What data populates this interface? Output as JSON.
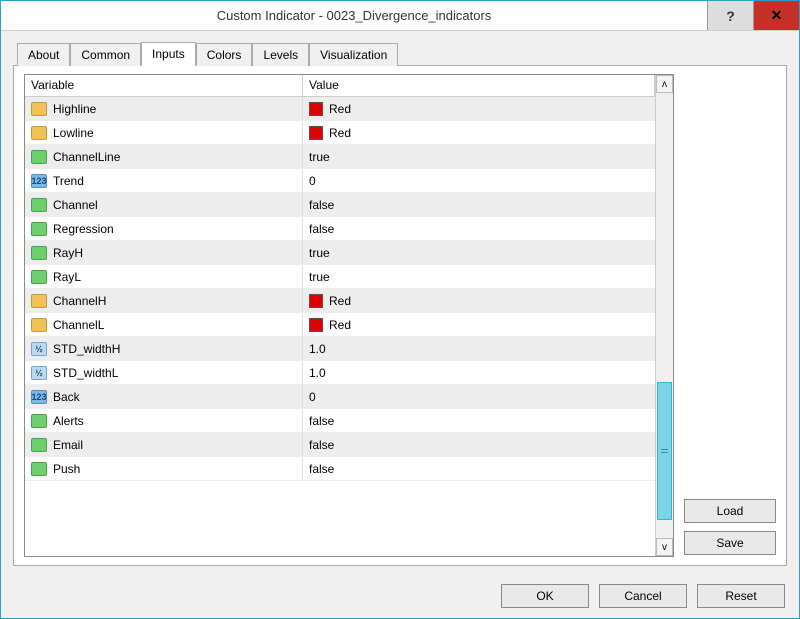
{
  "window": {
    "title": "Custom Indicator - 0023_Divergence_indicators"
  },
  "tabs": [
    {
      "label": "About"
    },
    {
      "label": "Common"
    },
    {
      "label": "Inputs"
    },
    {
      "label": "Colors"
    },
    {
      "label": "Levels"
    },
    {
      "label": "Visualization"
    }
  ],
  "active_tab": "Inputs",
  "grid": {
    "headers": {
      "variable": "Variable",
      "value": "Value"
    },
    "rows": [
      {
        "type": "color",
        "name": "Highline",
        "value": "Red",
        "swatch": "#e00000"
      },
      {
        "type": "color",
        "name": "Lowline",
        "value": "Red",
        "swatch": "#e00000"
      },
      {
        "type": "bool",
        "name": "ChannelLine",
        "value": "true"
      },
      {
        "type": "int",
        "name": "Trend",
        "value": "0"
      },
      {
        "type": "bool",
        "name": "Channel",
        "value": "false"
      },
      {
        "type": "bool",
        "name": "Regression",
        "value": "false"
      },
      {
        "type": "bool",
        "name": "RayH",
        "value": "true"
      },
      {
        "type": "bool",
        "name": "RayL",
        "value": "true"
      },
      {
        "type": "color",
        "name": "ChannelH",
        "value": "Red",
        "swatch": "#e00000"
      },
      {
        "type": "color",
        "name": "ChannelL",
        "value": "Red",
        "swatch": "#e00000"
      },
      {
        "type": "double",
        "name": "STD_widthH",
        "value": "1.0"
      },
      {
        "type": "double",
        "name": "STD_widthL",
        "value": "1.0"
      },
      {
        "type": "int",
        "name": "Back",
        "value": "0"
      },
      {
        "type": "bool",
        "name": "Alerts",
        "value": "false"
      },
      {
        "type": "bool",
        "name": "Email",
        "value": "false"
      },
      {
        "type": "bool",
        "name": "Push",
        "value": "false"
      }
    ]
  },
  "buttons": {
    "load": "Load",
    "save": "Save",
    "ok": "OK",
    "cancel": "Cancel",
    "reset": "Reset"
  },
  "icon_glyphs": {
    "int": "123",
    "double": "½",
    "help": "?",
    "close": "✕",
    "up": "ʌ",
    "down": "v"
  }
}
